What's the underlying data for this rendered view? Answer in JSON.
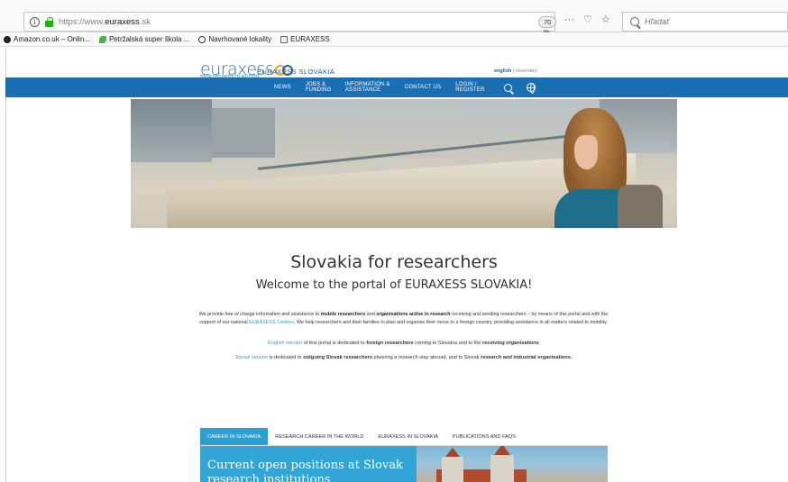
{
  "browser": {
    "url_scheme": "https://www.",
    "url_domain": "euraxess",
    "url_tld": ".sk",
    "zoom": "70 %",
    "toolbar_dots": "···",
    "search_placeholder": "Hľadať"
  },
  "bookmarks": [
    {
      "label": "Amazon.co.uk – Onlin...",
      "icon": "amazon-icon"
    },
    {
      "label": "Petržalská super škola ...",
      "icon": "leaf-icon"
    },
    {
      "label": "Navrhované lokality",
      "icon": "globe-icon"
    },
    {
      "label": "EURAXESS",
      "icon": "folder-icon"
    }
  ],
  "header": {
    "logo_word": "euraxess",
    "logo_tagline": "RESEARCHERS IN MOTION",
    "site_name": "EURAXESS SLOVAKIA",
    "lang_active": "english",
    "lang_sep": " | ",
    "lang_other": "slovensky"
  },
  "nav": {
    "items": [
      {
        "label": "NEWS"
      },
      {
        "label": "JOBS & FUNDING"
      },
      {
        "label": "INFORMATION & ASSISTANCE"
      },
      {
        "label": "CONTACT US"
      },
      {
        "label": "LOGIN / REGISTER"
      }
    ]
  },
  "main": {
    "headline": "Slovakia for researchers",
    "subheadline": "Welcome to the portal of EURAXESS SLOVAKIA!",
    "intro": {
      "p1": "We provide ",
      "free": "free of charge",
      "p2": " information and assistance to ",
      "mobile": "mobile researchers",
      "p3": " and ",
      "orgs": "organisations active in research",
      "p4": " receiving and sending researchers – by means of this portal and with the support of our national ",
      "centres": "EURAXESS Centres",
      "p5": ". We help researchers and their families to plan and organise their move to a foreign country, providing assistance in all matters related to mobility."
    },
    "english_para": {
      "link": "English version",
      "p1": " of this portal is dedicated to ",
      "b1": "foreign researchers",
      "p2": " coming to Slovakia and to the ",
      "b2": "receiving organisations"
    },
    "slovak_para": {
      "link": "Slovak version",
      "p1": " is dedicated to ",
      "b1": "outgoing Slovak researchers",
      "p2": " planning a research stay abroad, and to Slovak ",
      "b2": "research and industrial organisations."
    },
    "tabs": [
      {
        "label": "CAREER IN SLOVAKIA",
        "active": true
      },
      {
        "label": "RESEARCH CAREER IN THE WORLD",
        "active": false
      },
      {
        "label": "EURAXESS IN SLOVAKIA",
        "active": false
      },
      {
        "label": "PUBLICATIONS AND FAQS",
        "active": false
      }
    ],
    "panel_title": "Current open positions at Slovak research institutions"
  }
}
